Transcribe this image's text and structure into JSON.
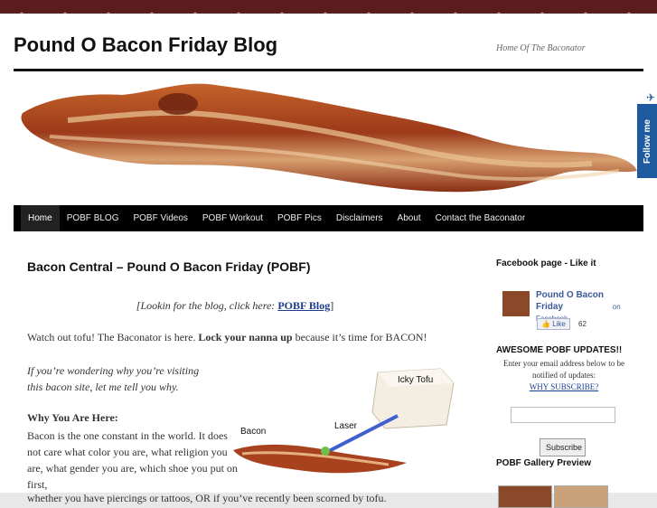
{
  "header": {
    "site_title": "Pound O Bacon Friday Blog",
    "site_description": "Home Of The Baconator",
    "follow_me": "Follow me"
  },
  "nav": {
    "items": [
      {
        "label": "Home"
      },
      {
        "label": "POBF BLOG"
      },
      {
        "label": "POBF Videos"
      },
      {
        "label": "POBF Workout"
      },
      {
        "label": "POBF Pics"
      },
      {
        "label": "Disclaimers"
      },
      {
        "label": "About"
      },
      {
        "label": "Contact the Baconator"
      }
    ]
  },
  "post": {
    "title": "Bacon Central – Pound O Bacon Friday (POBF)",
    "blog_line_prefix": "[Lookin for the blog, click here: ",
    "blog_link": "POBF Blog",
    "blog_line_suffix": "]",
    "intro_1": "Watch out tofu!  The Baconator is here.  ",
    "intro_bold": "Lock your nanna up",
    "intro_2": " because it’s time for BACON!",
    "italic_intro": "If you’re wondering why you’re visiting this bacon site, let me tell you why.",
    "why_heading": "Why You Are Here:",
    "why_body": "Bacon is the one constant in the world. It does not care what color you are, what religion you are, what gender you are, which shoe you put on first,",
    "last_line": "whether you have piercings or tattoos, OR if you’ve recently been scorned by tofu.",
    "illustration": {
      "icky_tofu": "Icky Tofu",
      "laser": "Laser",
      "bacon": "Bacon"
    }
  },
  "sidebar": {
    "facebook_heading": "Facebook page - Like it",
    "fb_page_name": "Pound O Bacon Friday",
    "fb_on": "on Facebook",
    "fb_like_label": "Like",
    "fb_like_count": "62",
    "updates_heading": "AWESOME POBF UPDATES!!",
    "updates_text": "Enter your email address below to be notified of updates:",
    "why_subscribe": "WHY SUBSCRIBE?",
    "subscribe_label": "Subscribe",
    "gallery_heading": "POBF Gallery Preview"
  },
  "colors": {
    "topbar": "#5a1c1c",
    "nav_bg": "#000000",
    "link": "#1a3d8f",
    "facebook_blue": "#3b5998",
    "follow_tab": "#1d5a9e"
  }
}
